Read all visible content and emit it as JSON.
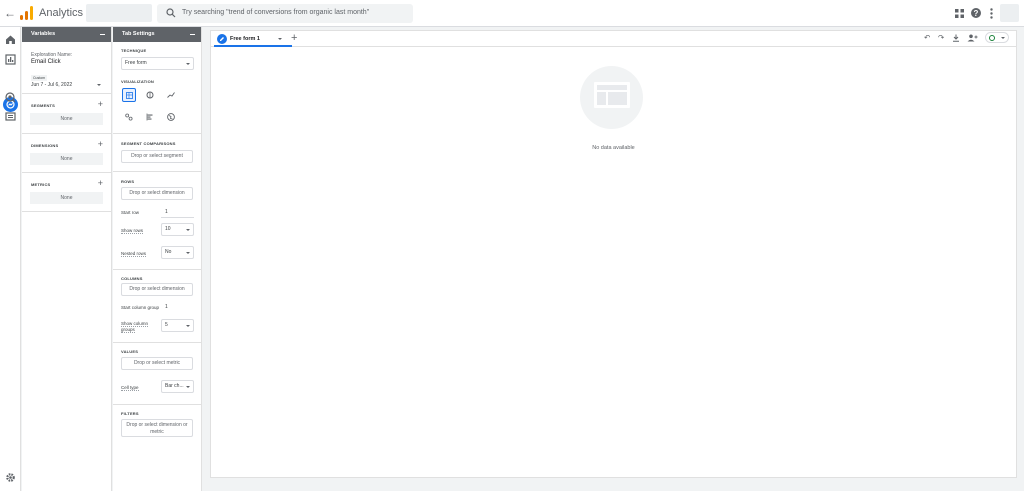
{
  "app": {
    "title": "Analytics",
    "search_placeholder": "Try searching \"trend of conversions from organic last month\""
  },
  "colors": {
    "accent": "#1a73e8",
    "header_bg": "#5f6368",
    "logo": [
      "#f9ab00",
      "#e37400",
      "#e37400"
    ]
  },
  "variables": {
    "header": "Variables",
    "exploration_name_label": "Exploration Name:",
    "exploration_name": "Email Click",
    "date_badge": "Custom",
    "date_range": "Jun 7 - Jul 6, 2022",
    "segments": {
      "label": "SEGMENTS",
      "empty": "None"
    },
    "dimensions": {
      "label": "DIMENSIONS",
      "empty": "None"
    },
    "metrics": {
      "label": "METRICS",
      "empty": "None"
    }
  },
  "tab_settings": {
    "header": "Tab Settings",
    "technique_label": "TECHNIQUE",
    "technique_value": "Free form",
    "visualization_label": "VISUALIZATION",
    "segment_comparisons_label": "SEGMENT COMPARISONS",
    "segment_drop": "Drop or select segment",
    "rows_label": "ROWS",
    "rows_drop": "Drop or select dimension",
    "start_row_label": "Start row",
    "start_row_value": "1",
    "show_rows_label": "Show rows",
    "show_rows_value": "10",
    "nested_rows_label": "Nested rows",
    "nested_rows_value": "No",
    "columns_label": "COLUMNS",
    "columns_drop": "Drop or select dimension",
    "start_column_group_label": "Start column group",
    "start_column_group_value": "1",
    "show_column_groups_label_1": "Show column",
    "show_column_groups_label_2": "groups",
    "show_column_groups_value": "5",
    "values_label": "VALUES",
    "values_drop": "Drop or select metric",
    "cell_type_label": "Cell type",
    "cell_type_value": "Bar ch...",
    "filters_label": "FILTERS",
    "filters_drop_1": "Drop or select dimension or",
    "filters_drop_2": "metric"
  },
  "canvas": {
    "tab_label": "Free form 1",
    "empty_message": "No data available"
  }
}
